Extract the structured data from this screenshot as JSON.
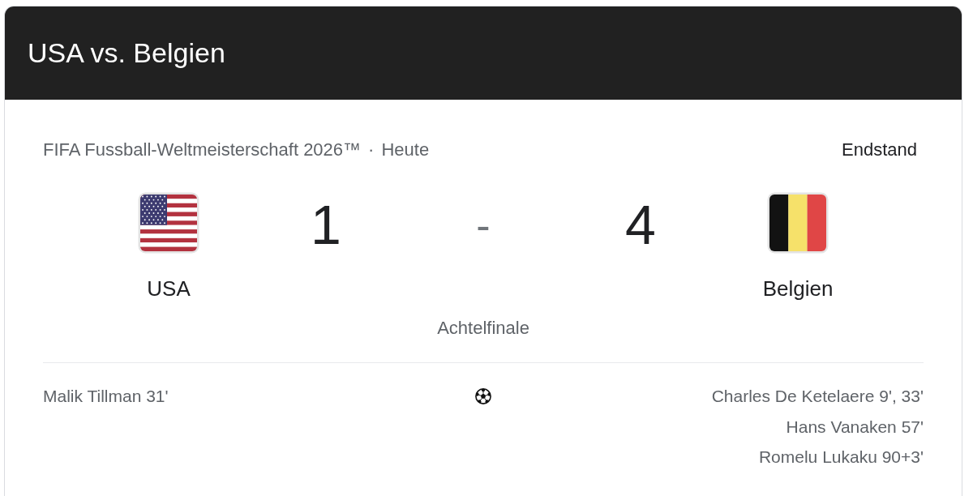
{
  "header": {
    "title": "USA vs. Belgien"
  },
  "match": {
    "competition": "FIFA Fussball-Weltmeisterschaft 2026™",
    "separator": "·",
    "date": "Heute",
    "status": "Endstand",
    "score_separator": "-",
    "round": "Achtelfinale",
    "teams": [
      {
        "name": "USA",
        "kind": "us",
        "score": "1",
        "scorers": [
          "Malik Tillman 31'"
        ]
      },
      {
        "name": "Belgien",
        "kind": "belgium",
        "score": "4",
        "scorers": [
          "Charles De Ketelaere 9', 33'",
          "Hans Vanaken 57'",
          "Romelu Lukaku 90+3'"
        ]
      }
    ]
  }
}
